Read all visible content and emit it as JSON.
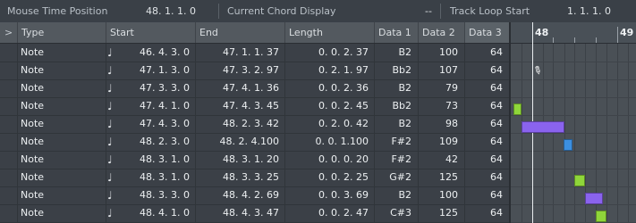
{
  "infobar": {
    "mouse_time_label": "Mouse Time Position",
    "mouse_time_value": "48. 1. 1.   0",
    "chord_label": "Current Chord Display",
    "chord_value": "--",
    "loop_label": "Track Loop Start",
    "loop_value": "1. 1. 1.   0"
  },
  "columns": [
    "",
    "Type",
    "Start",
    "End",
    "Length",
    "Data 1",
    "Data 2",
    "Data 3"
  ],
  "header_toggle": ">",
  "rows": [
    {
      "type": "Note",
      "start": "46. 4. 3.   0",
      "end": "47. 1. 1. 37",
      "length": "0. 0. 2. 37",
      "d1": "B2",
      "d2": "100",
      "d3": "64"
    },
    {
      "type": "Note",
      "start": "47. 1. 3.   0",
      "end": "47. 3. 2. 97",
      "length": "0. 2. 1. 97",
      "d1": "Bb2",
      "d2": "107",
      "d3": "64"
    },
    {
      "type": "Note",
      "start": "47. 3. 3.   0",
      "end": "47. 4. 1. 36",
      "length": "0. 0. 2. 36",
      "d1": "B2",
      "d2": "79",
      "d3": "64"
    },
    {
      "type": "Note",
      "start": "47. 4. 1.   0",
      "end": "47. 4. 3. 45",
      "length": "0. 0. 2. 45",
      "d1": "Bb2",
      "d2": "73",
      "d3": "64"
    },
    {
      "type": "Note",
      "start": "47. 4. 3.   0",
      "end": "48. 2. 3. 42",
      "length": "0. 2. 0. 42",
      "d1": "B2",
      "d2": "98",
      "d3": "64"
    },
    {
      "type": "Note",
      "start": "48. 2. 3.   0",
      "end": "48. 2. 4.100",
      "length": "0. 0. 1.100",
      "d1": "F#2",
      "d2": "109",
      "d3": "64"
    },
    {
      "type": "Note",
      "start": "48. 3. 1.   0",
      "end": "48. 3. 1. 20",
      "length": "0. 0. 0. 20",
      "d1": "F#2",
      "d2": "42",
      "d3": "64"
    },
    {
      "type": "Note",
      "start": "48. 3. 1.   0",
      "end": "48. 3. 3. 25",
      "length": "0. 0. 2. 25",
      "d1": "G#2",
      "d2": "125",
      "d3": "64"
    },
    {
      "type": "Note",
      "start": "48. 3. 3.   0",
      "end": "48. 4. 2. 69",
      "length": "0. 0. 3. 69",
      "d1": "B2",
      "d2": "100",
      "d3": "64"
    },
    {
      "type": "Note",
      "start": "48. 4. 1.   0",
      "end": "48. 4. 3. 47",
      "length": "0. 0. 2. 47",
      "d1": "C#3",
      "d2": "125",
      "d3": "64"
    }
  ],
  "ruler": {
    "bar_a": "48",
    "bar_b": "49"
  },
  "icons": {
    "note": "quarter-note-icon",
    "pencil": "pencil-tool-icon"
  },
  "colors": {
    "green": "#8fd63a",
    "purple": "#8a63ee",
    "blue": "#3c8fe0"
  }
}
